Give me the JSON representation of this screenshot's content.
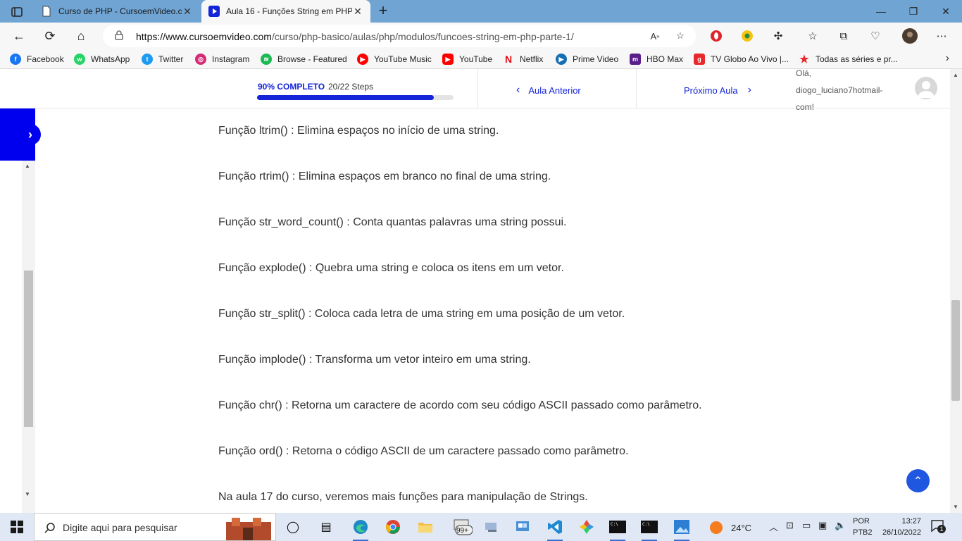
{
  "browser": {
    "tabs": [
      {
        "title": "Curso de PHP - CursoemVideo.c",
        "active": false
      },
      {
        "title": "Aula 16 - Funções String em PHP",
        "active": true
      }
    ],
    "new_tab": "+",
    "url_host": "https://www.cursoemvideo.com",
    "url_path": "/curso/php-basico/aulas/php/modulos/funcoes-string-em-php-parte-1/",
    "window_controls": {
      "minimize": "—",
      "maximize": "❐",
      "close": "✕"
    }
  },
  "favorites": [
    {
      "label": "Facebook",
      "color": "#1877f2"
    },
    {
      "label": "WhatsApp",
      "color": "#25d366"
    },
    {
      "label": "Twitter",
      "color": "#1d9bf0"
    },
    {
      "label": "Instagram",
      "color": "#d62976"
    },
    {
      "label": "Browse - Featured",
      "color": "#1db954"
    },
    {
      "label": "YouTube Music",
      "color": "#ff0000"
    },
    {
      "label": "YouTube",
      "color": "#ff0000"
    },
    {
      "label": "Netflix",
      "color": "#e50914"
    },
    {
      "label": "Prime Video",
      "color": "#146eb4"
    },
    {
      "label": "HBO Max",
      "color": "#5a1e8a"
    },
    {
      "label": "TV Globo Ao Vivo |...",
      "color": "#e8282b"
    },
    {
      "label": "Todas as séries e pr...",
      "color": "#e8282b"
    }
  ],
  "lesson": {
    "progress_label": "90% COMPLETO",
    "progress_steps": "20/22 Steps",
    "progress_fraction": 0.9,
    "prev_label": "Aula Anterior",
    "next_label": "Próximo Aula",
    "greeting": "Olá,",
    "username": "diogo_luciano7hotmail-",
    "username_suffix": "com!"
  },
  "content": {
    "paragraphs": [
      "Função ltrim() : Elimina espaços no início de uma string.",
      "Função rtrim() : Elimina espaços em branco no final de uma string.",
      "Função str_word_count() : Conta quantas palavras uma string possui.",
      "Função explode() : Quebra uma string e coloca os itens em um vetor.",
      "Função str_split() : Coloca cada letra de uma string em uma posição de um vetor.",
      "Função implode() : Transforma um vetor inteiro em uma string.",
      "Função chr() : Retorna um caractere de acordo com seu código ASCII passado como parâmetro.",
      "Função ord() : Retorna o código ASCII de um caractere passado como parâmetro.",
      "Na aula 17 do curso, veremos mais funções para manipulação de Strings."
    ]
  },
  "taskbar": {
    "search_placeholder": "Digite aqui para pesquisar",
    "mail_badge": "99+",
    "weather": "24°C",
    "lang_top": "POR",
    "lang_bottom": "PTB2",
    "time": "13:27",
    "date": "26/10/2022",
    "notification_count": "1"
  },
  "colors": {
    "accent": "#1424d9",
    "tabbar": "#6fa4d3",
    "taskbar": "#dfe8f4"
  }
}
